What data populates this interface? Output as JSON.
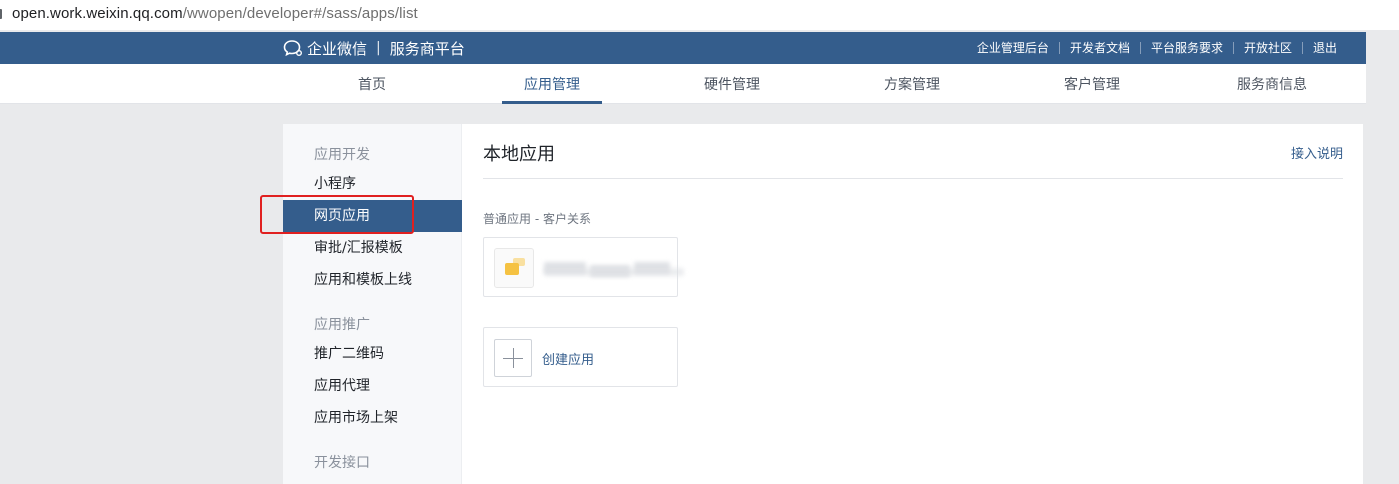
{
  "browser": {
    "url_host": "open.work.weixin.qq.com",
    "url_path": "/wwopen/developer#/sass/apps/list"
  },
  "header": {
    "brand": "企业微信",
    "separator": "|",
    "platform": "服务商平台",
    "links": [
      "企业管理后台",
      "开发者文档",
      "平台服务要求",
      "开放社区",
      "退出"
    ]
  },
  "mainnav": {
    "tabs": [
      {
        "label": "首页",
        "active": false
      },
      {
        "label": "应用管理",
        "active": true
      },
      {
        "label": "硬件管理",
        "active": false
      },
      {
        "label": "方案管理",
        "active": false
      },
      {
        "label": "客户管理",
        "active": false
      },
      {
        "label": "服务商信息",
        "active": false
      }
    ]
  },
  "sidebar": {
    "group1": "应用开发",
    "items1": [
      "小程序",
      "网页应用",
      "审批/汇报模板",
      "应用和模板上线"
    ],
    "group2": "应用推广",
    "items2": [
      "推广二维码",
      "应用代理",
      "应用市场上架"
    ],
    "group3": "开发接口",
    "active_item": "网页应用"
  },
  "content": {
    "title": "本地应用",
    "help_link": "接入说明",
    "section_label": "普通应用 - 客户关系",
    "create_label": "创建应用"
  },
  "colors": {
    "brand_blue": "#345d8c",
    "highlight_red": "#e02020",
    "app_icon_yellow": "#f5c242"
  }
}
